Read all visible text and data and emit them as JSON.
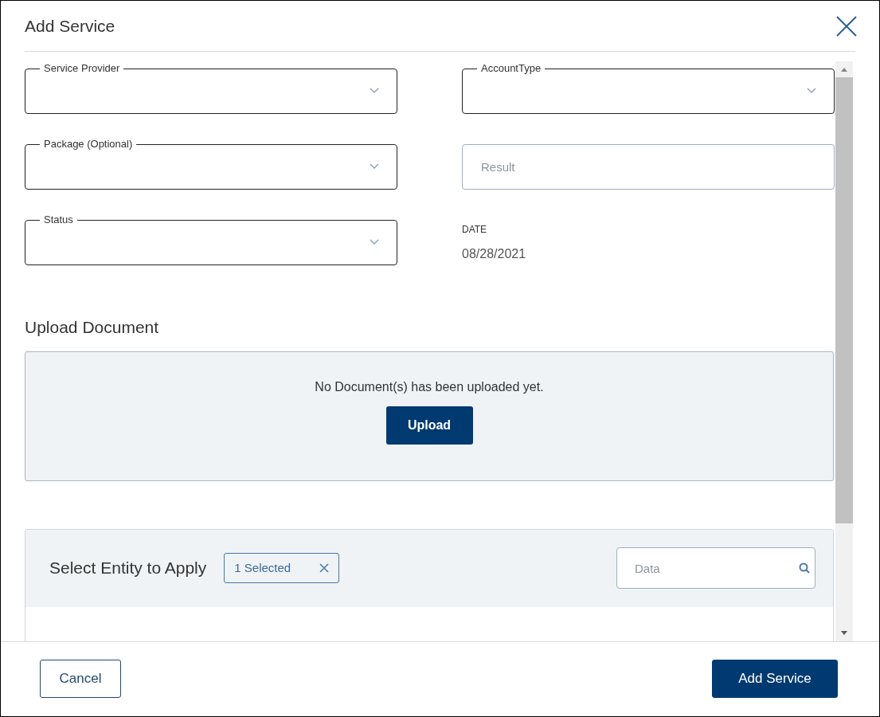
{
  "dialog": {
    "title": "Add Service"
  },
  "fields": [
    {
      "kind": "select",
      "label": "Service Provider"
    },
    {
      "kind": "select",
      "label": "AccountType"
    },
    {
      "kind": "select",
      "label": "Package (Optional)"
    },
    {
      "kind": "text",
      "placeholder": "Result"
    },
    {
      "kind": "select",
      "label": "Status"
    },
    {
      "kind": "static",
      "label": "DATE",
      "value": "08/28/2021"
    }
  ],
  "upload": {
    "heading": "Upload Document",
    "message": "No Document(s) has been uploaded yet.",
    "button": "Upload"
  },
  "entity": {
    "heading": "Select Entity to Apply",
    "chip": "1 Selected",
    "search": {
      "placeholder": "Data"
    }
  },
  "buttons": [
    {
      "label": "Cancel",
      "kind": "secondary"
    },
    {
      "label": "Add Service",
      "kind": "primary"
    }
  ]
}
